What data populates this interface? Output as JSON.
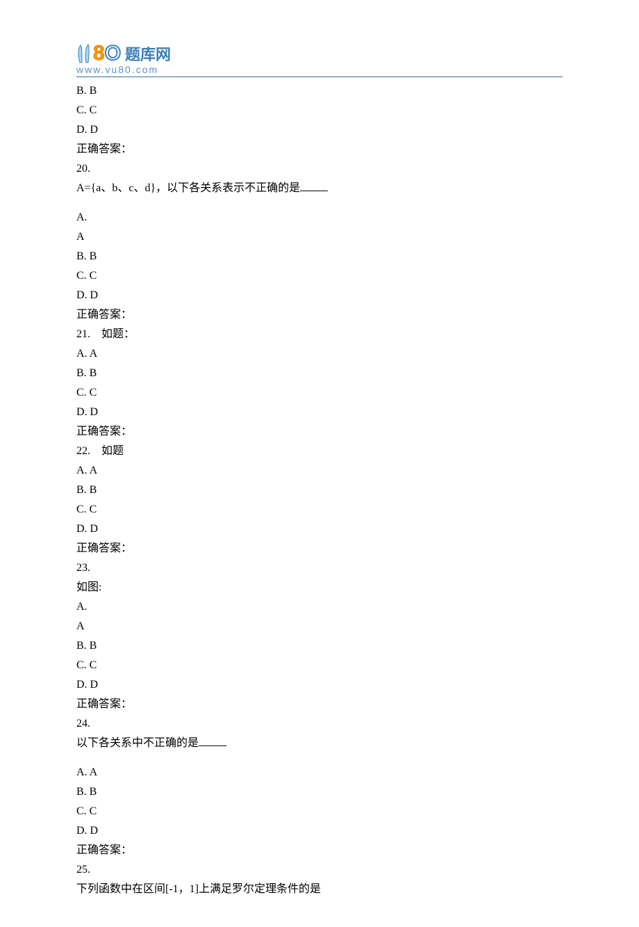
{
  "header": {
    "logo_8": "8",
    "logo_0": "O",
    "logo_text": "题库网",
    "logo_url": "www.vu80.com"
  },
  "entries": [
    {
      "kind": "line",
      "text": "B. B"
    },
    {
      "kind": "line",
      "text": "C. C"
    },
    {
      "kind": "line",
      "text": "D. D"
    },
    {
      "kind": "line",
      "text": "正确答案："
    },
    {
      "kind": "line",
      "text": "20."
    },
    {
      "kind": "line_blank",
      "text": "A={a、b、c、d}，以下各关系表示不正确的是"
    },
    {
      "kind": "spacer"
    },
    {
      "kind": "line",
      "text": "A."
    },
    {
      "kind": "line",
      "text": "A"
    },
    {
      "kind": "line",
      "text": "B. B"
    },
    {
      "kind": "line",
      "text": "C. C"
    },
    {
      "kind": "line",
      "text": "D. D"
    },
    {
      "kind": "line",
      "text": "正确答案："
    },
    {
      "kind": "line",
      "text": "21.　如题："
    },
    {
      "kind": "line",
      "text": "A. A"
    },
    {
      "kind": "line",
      "text": "B. B"
    },
    {
      "kind": "line",
      "text": "C. C"
    },
    {
      "kind": "line",
      "text": "D. D"
    },
    {
      "kind": "line",
      "text": "正确答案："
    },
    {
      "kind": "line",
      "text": "22.　如题"
    },
    {
      "kind": "line",
      "text": "A. A"
    },
    {
      "kind": "line",
      "text": "B. B"
    },
    {
      "kind": "line",
      "text": "C. C"
    },
    {
      "kind": "line",
      "text": "D. D"
    },
    {
      "kind": "line",
      "text": "正确答案："
    },
    {
      "kind": "line",
      "text": "23."
    },
    {
      "kind": "line",
      "text": "如图:"
    },
    {
      "kind": "line",
      "text": "A."
    },
    {
      "kind": "line",
      "text": "A"
    },
    {
      "kind": "line",
      "text": "B. B"
    },
    {
      "kind": "line",
      "text": "C. C"
    },
    {
      "kind": "line",
      "text": "D. D"
    },
    {
      "kind": "line",
      "text": "正确答案："
    },
    {
      "kind": "line",
      "text": "24."
    },
    {
      "kind": "line_blank",
      "text": "以下各关系中不正确的是"
    },
    {
      "kind": "spacer"
    },
    {
      "kind": "line",
      "text": "A. A"
    },
    {
      "kind": "line",
      "text": "B. B"
    },
    {
      "kind": "line",
      "text": "C. C"
    },
    {
      "kind": "line",
      "text": "D. D"
    },
    {
      "kind": "line",
      "text": "正确答案："
    },
    {
      "kind": "line",
      "text": "25."
    },
    {
      "kind": "line",
      "text": "下列函数中在区间[-1，1]上满足罗尔定理条件的是"
    }
  ]
}
